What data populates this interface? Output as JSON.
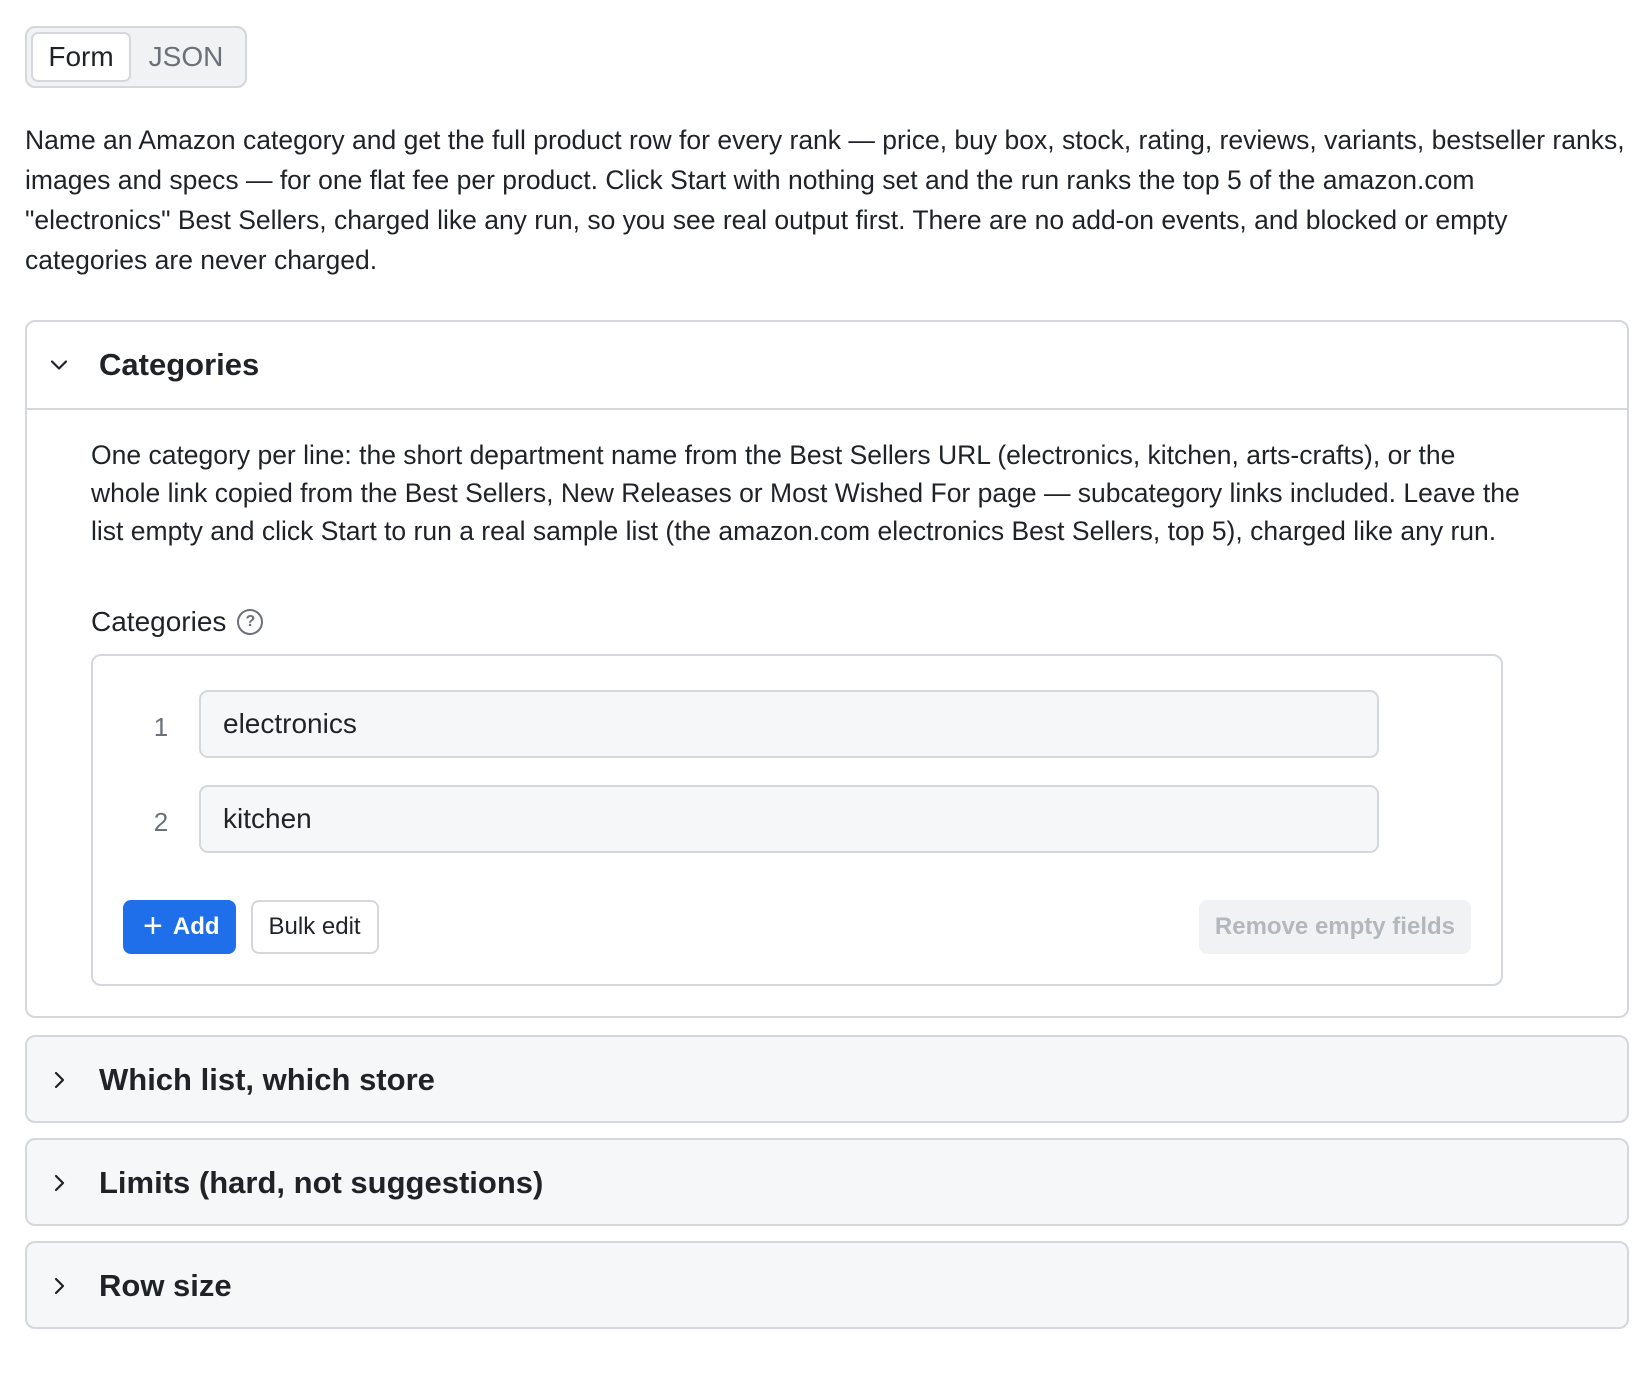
{
  "mode_toggle": {
    "form_label": "Form",
    "json_label": "JSON",
    "active": "Form"
  },
  "intro": "Name an Amazon category and get the full product row for every rank — price, buy box, stock, rating, reviews, variants, bestseller ranks, images and specs — for one flat fee per product. Click Start with nothing set and the run ranks the top 5 of the amazon.com \"electronics\" Best Sellers, charged like any run, so you see real output first. There are no add-on events, and blocked or empty categories are never charged.",
  "sections": {
    "categories": {
      "title": "Categories",
      "description": "One category per line: the short department name from the Best Sellers URL (electronics, kitchen, arts-crafts), or the whole link copied from the Best Sellers, New Releases or Most Wished For page — subcategory links included. Leave the list empty and click Start to run a real sample list (the amazon.com electronics Best Sellers, top 5), charged like any run.",
      "field_label": "Categories",
      "help_glyph": "?",
      "items": [
        {
          "num": "1",
          "value": "electronics"
        },
        {
          "num": "2",
          "value": "kitchen"
        }
      ],
      "add_plus": "+",
      "add_label": "Add",
      "bulk_edit_label": "Bulk edit",
      "remove_empty_label": "Remove empty fields"
    },
    "which_list": {
      "title": "Which list, which store"
    },
    "limits": {
      "title": "Limits (hard, not suggestions)"
    },
    "row_size": {
      "title": "Row size"
    }
  },
  "colors": {
    "accent": "#1f6feb",
    "border": "#d4d7dc",
    "muted_text": "#6b717a"
  }
}
